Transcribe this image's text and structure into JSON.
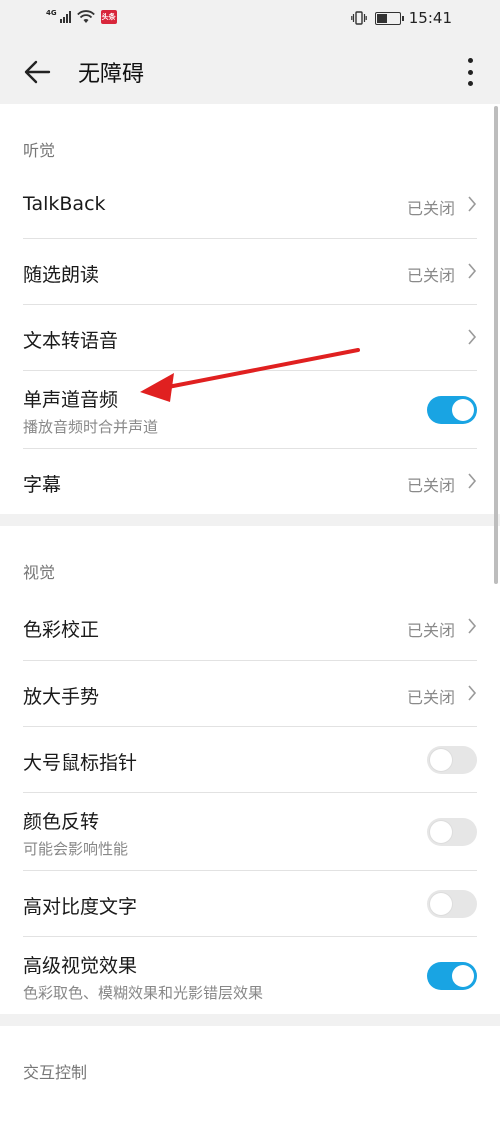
{
  "status_bar": {
    "network": "4G",
    "news_badge": "头条",
    "time": "15:41",
    "icons": [
      "signal-icon",
      "wifi-icon",
      "news-app-icon",
      "vibrate-icon",
      "battery-icon"
    ]
  },
  "header": {
    "title": "无障碍",
    "back_icon": "back-arrow-icon",
    "more_icon": "more-vertical-icon"
  },
  "sections": {
    "hearing": {
      "title": "听觉",
      "items": [
        {
          "label": "TalkBack",
          "status": "已关闭"
        },
        {
          "label": "随选朗读",
          "status": "已关闭"
        },
        {
          "label": "文本转语音"
        },
        {
          "label": "单声道音频",
          "subtitle": "播放音频时合并声道",
          "toggle": true
        },
        {
          "label": "字幕",
          "status": "已关闭"
        }
      ]
    },
    "vision": {
      "title": "视觉",
      "items": [
        {
          "label": "色彩校正",
          "status": "已关闭"
        },
        {
          "label": "放大手势",
          "status": "已关闭"
        },
        {
          "label": "大号鼠标指针",
          "toggle": false
        },
        {
          "label": "颜色反转",
          "subtitle": "可能会影响性能",
          "toggle": false
        },
        {
          "label": "高对比度文字",
          "toggle": false
        },
        {
          "label": "高级视觉效果",
          "subtitle": "色彩取色、模糊效果和光影错层效果",
          "toggle": true
        }
      ]
    },
    "interaction": {
      "title": "交互控制"
    }
  },
  "colors": {
    "toggle_on": "#19a4e3",
    "toggle_off": "#e6e6e6",
    "annotation_arrow": "#e02020"
  }
}
